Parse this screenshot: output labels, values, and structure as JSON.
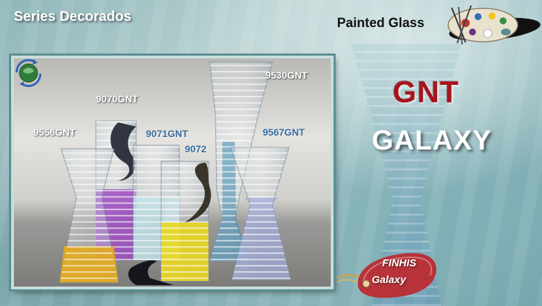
{
  "header": {
    "title": "Series Decorados",
    "right_title": "Painted Glass",
    "palette_icon": "artist-palette-icon"
  },
  "photo": {
    "logo_icon": "globe-arrows-icon",
    "codes": [
      "9556GNT",
      "9070GNT",
      "9071GNT",
      "9072",
      "9530GNT",
      "9567GNT"
    ]
  },
  "brand": {
    "name": "GNT",
    "series": "GALAXY"
  },
  "tag": {
    "line1": "FINHIS",
    "line2": "Galaxy"
  },
  "colors": {
    "brand_red": "#a8141b",
    "tag_red": "#b8323a",
    "frame_border": "#5b8d91"
  }
}
